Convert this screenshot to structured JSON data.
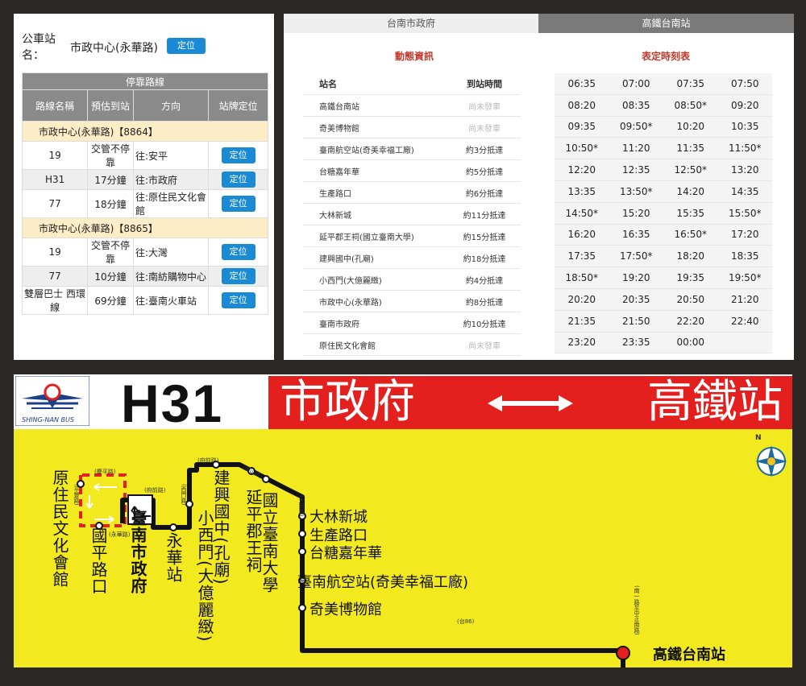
{
  "stop": {
    "label": "公車站名：",
    "name": "市政中心(永華路)",
    "locate": "定位"
  },
  "routes_table": {
    "caption": "停靠路線",
    "headers": [
      "路線名稱",
      "預估到站",
      "方向",
      "站牌定位"
    ],
    "groups": [
      {
        "title": "市政中心(永華路)【8864】",
        "rows": [
          {
            "route": "19",
            "eta": "交管不停靠",
            "dir": "往:安平",
            "btn": "定位"
          },
          {
            "route": "H31",
            "eta": "17分鐘",
            "dir": "往:市政府",
            "btn": "定位"
          },
          {
            "route": "77",
            "eta": "18分鐘",
            "dir": "往:原住民文化會館",
            "btn": "定位"
          }
        ]
      },
      {
        "title": "市政中心(永華路)【8865】",
        "rows": [
          {
            "route": "19",
            "eta": "交管不停靠",
            "dir": "往:大灣",
            "btn": "定位"
          },
          {
            "route": "77",
            "eta": "10分鐘",
            "dir": "往:南紡購物中心",
            "btn": "定位"
          },
          {
            "route": "雙層巴士 西環線",
            "eta": "69分鐘",
            "dir": "往:臺南火車站",
            "btn": "定位"
          }
        ]
      }
    ]
  },
  "tabs": [
    "台南市政府",
    "高鐵台南站"
  ],
  "dynamic": {
    "title": "動態資訊",
    "col_station": "站名",
    "col_time": "到站時間",
    "rows": [
      {
        "station": "高鐵台南站",
        "time": "尚未發車"
      },
      {
        "station": "奇美博物館",
        "time": "尚未發車"
      },
      {
        "station": "臺南航空站(奇美幸福工廠)",
        "time": "約3分抵達"
      },
      {
        "station": "台糖嘉年華",
        "time": "約5分抵達"
      },
      {
        "station": "生產路口",
        "time": "約6分抵達"
      },
      {
        "station": "大林新城",
        "time": "約11分抵達"
      },
      {
        "station": "延平郡王祠(國立臺南大學)",
        "time": "約15分抵達"
      },
      {
        "station": "建興國中(孔廟)",
        "time": "約18分抵達"
      },
      {
        "station": "小西門(大億麗緻)",
        "time": "約4分抵達"
      },
      {
        "station": "市政中心(永華路)",
        "time": "約8分抵達"
      },
      {
        "station": "臺南市政府",
        "time": "約10分抵達"
      },
      {
        "station": "原住民文化會館",
        "time": "尚未發車"
      }
    ]
  },
  "schedule": {
    "title": "表定時刻表",
    "times": [
      "06:35",
      "07:00",
      "07:35",
      "07:50",
      "08:20",
      "08:35",
      "08:50*",
      "09:20",
      "09:35",
      "09:50*",
      "10:20",
      "10:35",
      "10:50*",
      "11:20",
      "11:35",
      "11:50*",
      "12:20",
      "12:35",
      "12:50*",
      "13:20",
      "13:35",
      "13:50*",
      "14:20",
      "14:35",
      "14:50*",
      "15:20",
      "15:35",
      "15:50*",
      "16:20",
      "16:35",
      "16:50*",
      "17:20",
      "17:35",
      "17:50*",
      "18:20",
      "18:35",
      "18:50*",
      "19:20",
      "19:35",
      "19:50*",
      "20:20",
      "20:35",
      "20:50",
      "21:20",
      "21:35",
      "21:50",
      "22:20",
      "22:40",
      "23:20",
      "23:35",
      "00:00",
      ""
    ]
  },
  "banner": {
    "logo_text": "SHING-NAN BUS",
    "route": "H31",
    "from": "市政府",
    "to": "高鐵站",
    "stations": {
      "s1": "原住民文化會館",
      "s2": "國平路口",
      "s3": "臺南市政府",
      "s4": "永華站",
      "s5": "小西門(大億麗緻)",
      "s6": "建興國中(孔廟)",
      "s7": "延平郡王祠",
      "s8": "國立臺南大學",
      "s9": "大林新城",
      "s10": "生產路口",
      "s11": "台糖嘉年華",
      "s12": "臺南航空站(奇美幸福工廠)",
      "s13": "奇美博物館",
      "s14": "高鐵台南站"
    },
    "roads": {
      "r1": "(慶平路)",
      "r2": "(平豐路)",
      "r3": "(永華路)",
      "r4": "(府前路)",
      "r5": "(西門路)",
      "r6": "(府前路)",
      "r7": "(開山路)",
      "r8": "(大同路)",
      "r9": "(台86)",
      "r10": "(南一路至中正南路)"
    },
    "compass": "N",
    "colors": {
      "red": "#e3201e",
      "yellow": "#f2ea1e",
      "blue": "#1a8ad4"
    }
  }
}
